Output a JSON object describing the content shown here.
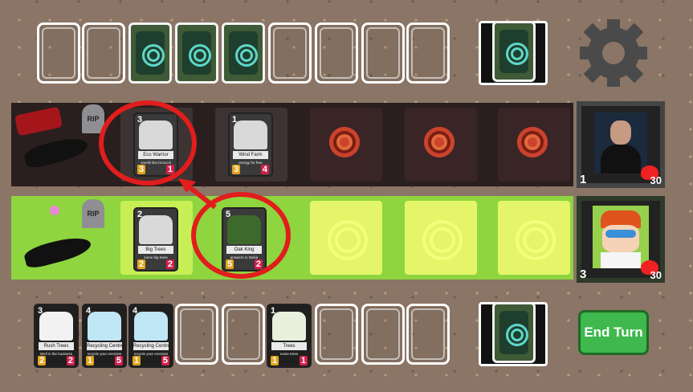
{
  "top_row": {
    "slot_count": 9
  },
  "settings": {
    "icon": "gear-icon"
  },
  "enemy": {
    "hero_name": "",
    "mana": "1",
    "health": "30",
    "lane_cards": [
      {
        "name": "Eco Warrior",
        "desc": "smells like broccoli",
        "cost": "3",
        "attack": "3",
        "health": "1"
      },
      {
        "name": "Wind Farm",
        "desc": "energy for free",
        "cost": "1",
        "attack": "3",
        "health": "4"
      }
    ]
  },
  "player": {
    "mana": "3",
    "health": "30",
    "lane_cards": [
      {
        "name": "Big Trees",
        "desc": "some big trees",
        "cost": "2",
        "attack": "2",
        "health": "2"
      },
      {
        "name": "Oak King",
        "desc": "answers to Dekie",
        "cost": "5",
        "attack": "5",
        "health": "2"
      }
    ],
    "hand": [
      {
        "name": "Rush Trees",
        "desc": "Well in the business",
        "cost": "3",
        "attack": "2",
        "health": "2"
      },
      {
        "name": "Recycling Centre",
        "desc": "recycle your enemies",
        "cost": "4",
        "attack": "1",
        "health": "5"
      },
      {
        "name": "Recycling Centre",
        "desc": "recycle your enemies",
        "cost": "4",
        "attack": "1",
        "health": "5"
      },
      {
        "name": "Trees",
        "desc": "some trees",
        "cost": "1",
        "attack": "1",
        "health": "1"
      }
    ]
  },
  "graves": {
    "enemy": "RIP",
    "player": "RIP"
  },
  "end_turn": {
    "label": "End Turn"
  },
  "colors": {
    "enemy_lane": "#2a1f1e",
    "player_lane": "#8ed53f",
    "attack_marker": "#e11d1d",
    "end_turn": "#3fb84d"
  }
}
